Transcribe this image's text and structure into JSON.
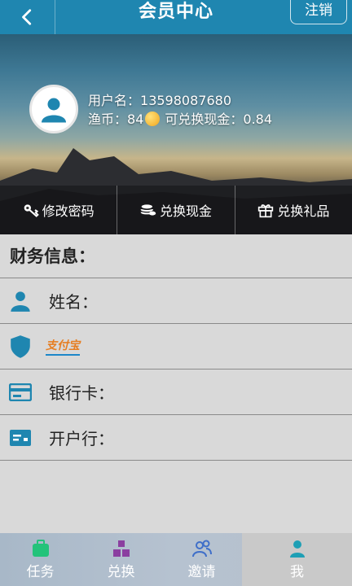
{
  "header": {
    "back_icon": "chevron-left-icon",
    "title": "会员中心",
    "logout_label": "注销"
  },
  "profile": {
    "username_label": "用户名：",
    "username": "13598087680",
    "coin_label": "渔币：",
    "coin_value": "84",
    "cash_label": "可兑换现金：",
    "cash_value": "0.84"
  },
  "actions": [
    {
      "label": "修改密码",
      "icon": "key-icon"
    },
    {
      "label": "兑换现金",
      "icon": "coins-icon"
    },
    {
      "label": "兑换礼品",
      "icon": "gift-icon"
    }
  ],
  "finance": {
    "title": "财务信息：",
    "name_label": "姓名：",
    "alipay_logo": "支付宝",
    "bank_card_label": "银行卡：",
    "bank_label": "开户行："
  },
  "tabs": [
    {
      "label": "任务",
      "icon": "briefcase-icon"
    },
    {
      "label": "兑换",
      "icon": "blocks-icon"
    },
    {
      "label": "邀请",
      "icon": "people-icon"
    },
    {
      "label": "我",
      "icon": "user-icon",
      "active": true
    }
  ],
  "colors": {
    "primary": "#1f86b0",
    "icon_blue": "#1f86b0",
    "task": "#23c37a",
    "exchange": "#8b3fa0",
    "invite": "#3f6fc9",
    "me": "#1e9fb5"
  }
}
